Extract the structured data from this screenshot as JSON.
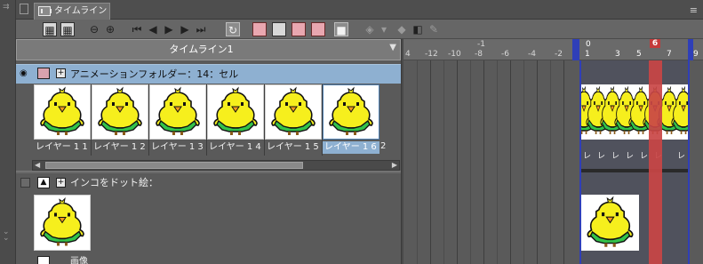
{
  "panel": {
    "tab_label": "タイムライン",
    "menu_glyph": "≡"
  },
  "toolbar": {
    "icons": [
      "new-timeline-icon",
      "edit-timeline-icon",
      "zoom-out-icon",
      "zoom-in-icon",
      "first-frame-icon",
      "prev-frame-icon",
      "play-icon",
      "next-frame-icon",
      "last-frame-icon",
      "loop-icon",
      "new-animation-folder-icon",
      "new-animation-cel-icon",
      "assign-cel-icon",
      "specify-cel-icon",
      "onion-skin-icon",
      "keyframe-icon",
      "keyframe-add-icon",
      "property-icon",
      "pen-icon"
    ]
  },
  "timeline": {
    "name": "タイムライン1"
  },
  "layers": {
    "folder": {
      "label": "アニメーションフォルダー：14：セル",
      "cells": [
        {
          "label": "レイヤー 1 1"
        },
        {
          "label": "レイヤー 1 2"
        },
        {
          "label": "レイヤー 1 3"
        },
        {
          "label": "レイヤー 1 4"
        },
        {
          "label": "レイヤー 1 5"
        },
        {
          "label": "レイヤー 1 6"
        }
      ],
      "extra_label": "2"
    },
    "raster": {
      "label": "インコをドット絵："
    },
    "bottom": {
      "label": "画像"
    }
  },
  "ruler": {
    "minus_label": "-1",
    "zero_label": "0",
    "current_frame": "6",
    "numbers": [
      "4",
      "-12",
      "-10",
      "-8",
      "-6",
      "-4",
      "-2",
      "1",
      "3",
      "5",
      "7",
      "9"
    ]
  },
  "grid": {
    "cel_marks": [
      "レ",
      "レ",
      "レ",
      "レ",
      "レ",
      "レ",
      "レ"
    ]
  },
  "colors": {
    "selection_blue": "#8eb0d1",
    "current_frame_red": "#c43b3b",
    "range_marker": "#2f3fb8"
  }
}
